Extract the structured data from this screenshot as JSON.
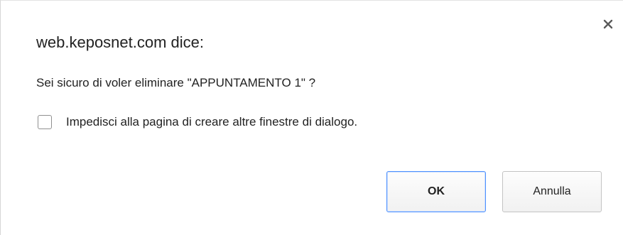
{
  "dialog": {
    "title": "web.keposnet.com dice:",
    "message": "Sei sicuro di voler eliminare \"APPUNTAMENTO 1\" ?",
    "suppress_label": "Impedisci alla pagina di creare altre finestre di dialogo.",
    "suppress_checked": false,
    "ok_label": "OK",
    "cancel_label": "Annulla",
    "close_icon": "close-icon",
    "accent_color": "#4d90fe"
  }
}
